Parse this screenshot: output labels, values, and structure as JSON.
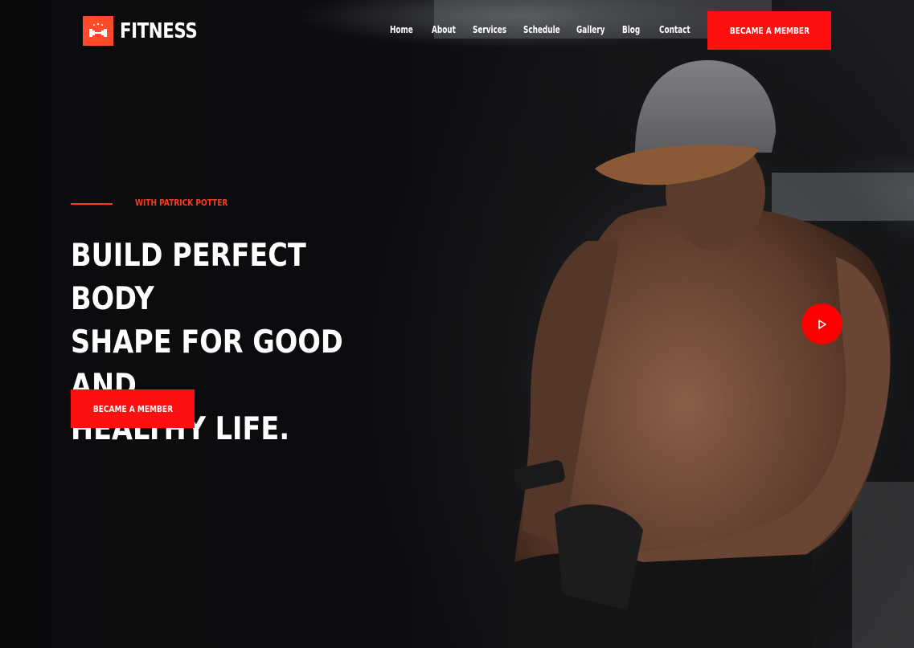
{
  "brand": {
    "name": "FITNESS",
    "icon": "dumbbell-icon",
    "accent": "#ff4a2b"
  },
  "nav": {
    "items": [
      "Home",
      "About",
      "Services",
      "Schedule",
      "Gallery",
      "Blog",
      "Contact"
    ],
    "cta_label": "BECAME A MEMBER"
  },
  "hero": {
    "tagline": "WITH PATRICK POTTER",
    "headline_lines": [
      "BUILD PERFECT BODY",
      "SHAPE FOR GOOD AND",
      "HEALTHY LIFE."
    ],
    "cta_label": "BECAME A MEMBER",
    "play_icon": "play-icon"
  },
  "colors": {
    "accent": "#ff0f0f",
    "tagline": "#ff3b1f",
    "background": "#0b0c0e"
  }
}
